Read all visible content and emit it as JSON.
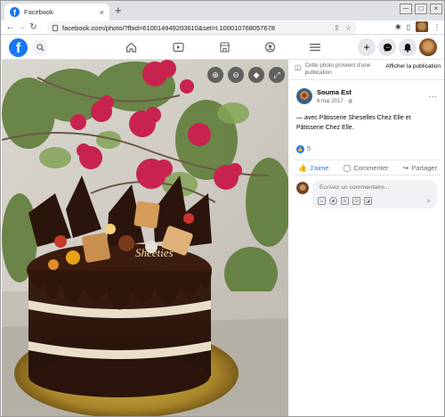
{
  "browser": {
    "tab_title": "Facebook",
    "tab_close": "×",
    "new_tab": "+",
    "url": "facebook.com/photo/?fbid=610014949203610&set=t.100010768057678",
    "win_min": "─",
    "win_max": "□",
    "win_close": "×"
  },
  "fb": {
    "logo": "f",
    "nav_icons": [
      "home-icon",
      "video-icon",
      "marketplace-icon",
      "groups-icon",
      "menu-icon"
    ],
    "right_icons": [
      "plus-icon",
      "messenger-icon",
      "bell-icon",
      "profile-avatar"
    ]
  },
  "notice": {
    "text": "Cette photo provient d'une publication.",
    "link": "Afficher la publication"
  },
  "post": {
    "author": "Souma Est",
    "date": "6 mai 2017 · ",
    "caption_prefix": "— avec ",
    "tag1": "Pâtisserie Sheselles Chez Elle",
    "caption_mid": " et ",
    "tag2": "Pâtisserie Chez Elle",
    "caption_suffix": ".",
    "reaction_count": "5",
    "like_label": "J'aime",
    "comment_label": "Commenter",
    "share_label": "Partager",
    "comment_placeholder": "Écrivez un commentaire..."
  },
  "photo": {
    "cake_text": "Sheeties"
  },
  "colors": {
    "brand": "#1877f2",
    "text": "#050505",
    "muted": "#65676b"
  }
}
